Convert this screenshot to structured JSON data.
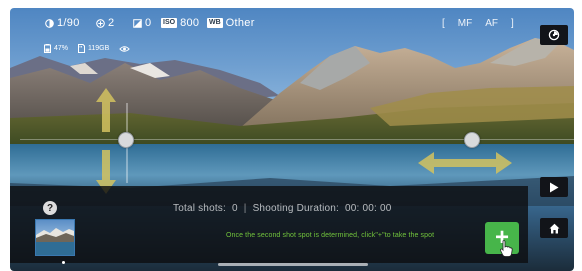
{
  "topbar": {
    "shutter": "1/90",
    "exposure": "2",
    "ev": "0",
    "iso_label": "ISO",
    "iso_value": "800",
    "wb_label": "WB",
    "wb_value": "Other",
    "mf": "MF",
    "af": "AF"
  },
  "status": {
    "battery": "47%",
    "storage": "119GB"
  },
  "panel": {
    "help_glyph": "?",
    "total_shots_label": "Total shots:",
    "total_shots_value": "0",
    "separator": "|",
    "duration_label": "Shooting Duration:",
    "duration_value": "00: 00: 00",
    "hint": "Once the second shot spot is determined,  click\"+\"to take the spot",
    "add_glyph": "+"
  },
  "icons": {
    "camera_switch": "camera-switch-icon",
    "play": "play-icon",
    "home": "home-icon"
  },
  "colors": {
    "accent_green": "#47b54a",
    "hint_green": "#72c53c",
    "arrow_yellow": "#d2c25f"
  }
}
